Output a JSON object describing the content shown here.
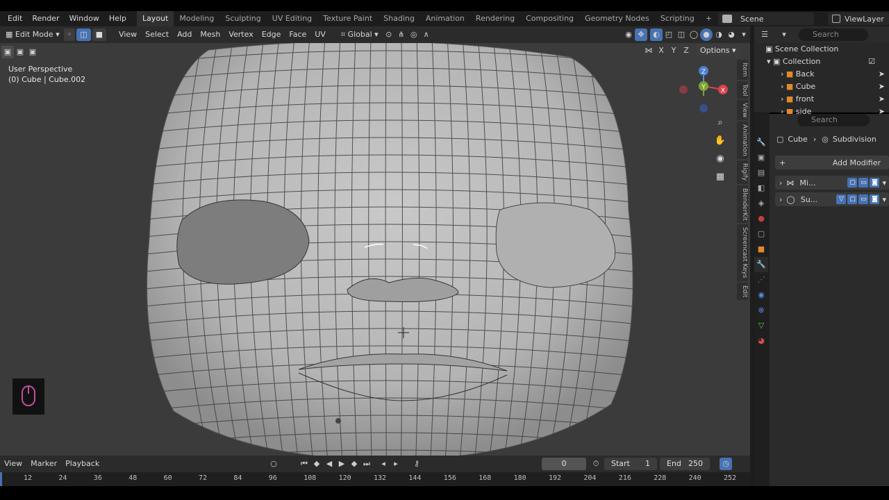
{
  "menu": [
    "Edit",
    "Render",
    "Window",
    "Help"
  ],
  "workspaces": [
    {
      "label": "Layout",
      "active": true
    },
    {
      "label": "Modeling"
    },
    {
      "label": "Sculpting"
    },
    {
      "label": "UV Editing"
    },
    {
      "label": "Texture Paint"
    },
    {
      "label": "Shading"
    },
    {
      "label": "Animation"
    },
    {
      "label": "Rendering"
    },
    {
      "label": "Compositing"
    },
    {
      "label": "Geometry Nodes"
    },
    {
      "label": "Scripting"
    }
  ],
  "add_workspace": "+",
  "scene": "Scene",
  "view_layer": "ViewLayer",
  "viewport_header": {
    "mode": "Edit Mode",
    "menus": [
      "View",
      "Select",
      "Add",
      "Mesh",
      "Vertex",
      "Edge",
      "Face",
      "UV"
    ],
    "transform": "Global",
    "options": "Options",
    "axes": [
      "X",
      "Y",
      "Z"
    ]
  },
  "viewport_overlay": {
    "perspective": "User Perspective",
    "object": "(0) Cube | Cube.002"
  },
  "side_tabs": [
    "Item",
    "Tool",
    "View",
    "Animation",
    "Rigify",
    "BlenderKit",
    "Screencast Keys",
    "Edit"
  ],
  "gizmo": {
    "x": "X",
    "y": "Y",
    "z": "Z"
  },
  "outliner": {
    "search_placeholder": "Search",
    "root": "Scene Collection",
    "collection": "Collection",
    "items": [
      "Back",
      "Cube",
      "front",
      "side"
    ]
  },
  "properties": {
    "search_placeholder": "Search",
    "breadcrumb_object": "Cube",
    "breadcrumb_modifier": "Subdivision",
    "add_modifier": "Add Modifier",
    "modifiers": [
      "Mi...",
      "Su..."
    ]
  },
  "timeline": {
    "menus": [
      "View",
      "Marker",
      "Playback"
    ],
    "current_frame": "0",
    "start_label": "Start",
    "start": "1",
    "end_label": "End",
    "end": "250",
    "ticks": [
      "12",
      "24",
      "36",
      "48",
      "60",
      "72",
      "84",
      "96",
      "108",
      "120",
      "132",
      "144",
      "156",
      "168",
      "180",
      "192",
      "204",
      "216",
      "228",
      "240",
      "252"
    ]
  }
}
